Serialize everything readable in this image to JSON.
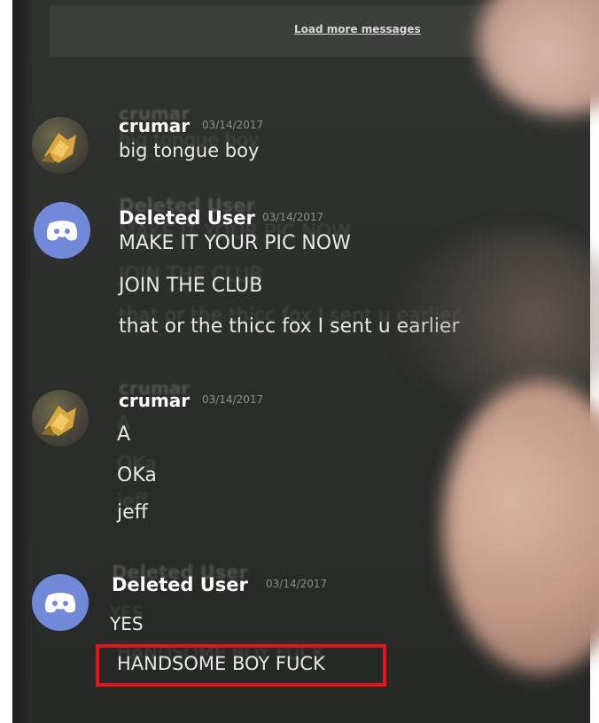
{
  "chat": {
    "load_more": "Load more messages",
    "messages": [
      {
        "username": "crumar",
        "timestamp": "03/14/2017",
        "avatar": "crumar-avatar",
        "lines": [
          "big tongue boy"
        ]
      },
      {
        "username": "Deleted User",
        "timestamp": "03/14/2017",
        "avatar": "discord-default-avatar",
        "lines": [
          "MAKE IT YOUR PIC NOW",
          "JOIN THE CLUB",
          "that or the thicc fox I sent u earlier"
        ]
      },
      {
        "username": "crumar",
        "timestamp": "03/14/2017",
        "avatar": "crumar-avatar",
        "lines": [
          "A",
          "OKa",
          "jeff"
        ]
      },
      {
        "username": "Deleted User",
        "timestamp": "03/14/2017",
        "avatar": "discord-default-avatar",
        "lines": [
          "YES",
          "HANDSOME BOY FUCK"
        ]
      }
    ]
  },
  "colors": {
    "chat_background": "#2d2f2d",
    "discord_avatar": "#7289da",
    "highlight_border": "#e2141c"
  }
}
